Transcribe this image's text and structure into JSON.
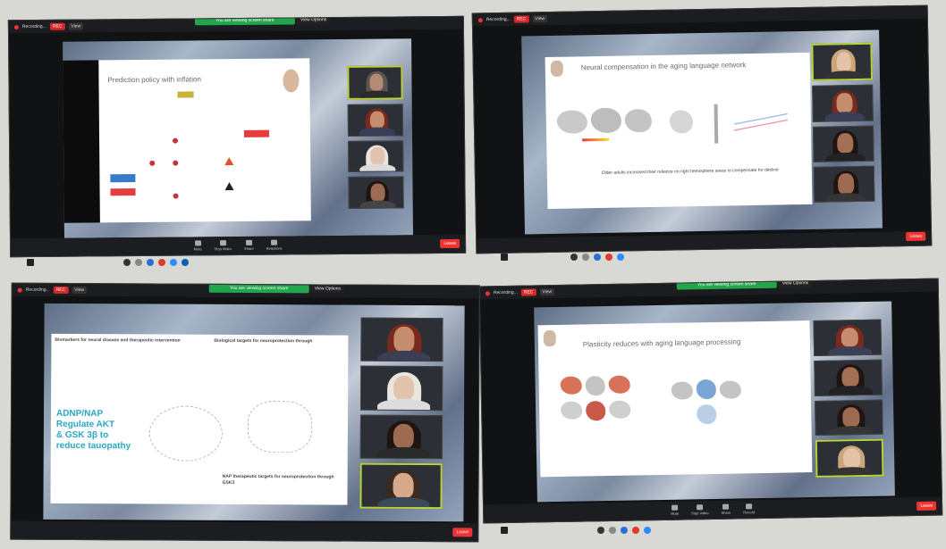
{
  "screens": [
    {
      "recording_label": "Recording...",
      "rec_badge": "REC",
      "view_label": "View",
      "share_banner": "You are viewing screen share",
      "stop_label": "View Options",
      "slide_title": "Prediction policy with inflation",
      "participants": [
        "",
        "",
        "",
        ""
      ]
    },
    {
      "recording_label": "Recording...",
      "rec_badge": "REC",
      "view_label": "View",
      "slide_title": "Neural compensation in the aging language network",
      "slide_caption": "Older adults increased their reliance on right hemisphere areas to compensate for decline",
      "participants": [
        "",
        "",
        "",
        ""
      ]
    },
    {
      "recording_label": "Recording...",
      "rec_badge": "REC",
      "view_label": "View",
      "share_banner": "You are viewing screen share",
      "stop_label": "View Options",
      "slide_heading_left": "Biomarkers for neural disease and therapeutic intervention",
      "slide_heading_right": "Biological targets for neuroprotection through",
      "slide_big_text": [
        "ADNP/NAP",
        "Regulate AKT",
        "& GSK 3β to",
        "reduce tauopathy"
      ],
      "slide_footer_text": "NAP therapeutic targets for neuroprotection through GSK3",
      "participants": [
        "",
        "",
        "",
        ""
      ]
    },
    {
      "recording_label": "Recording...",
      "rec_badge": "REC",
      "view_label": "View",
      "share_banner": "You are viewing screen share",
      "stop_label": "View Options",
      "slide_title": "Plasticity reduces with aging language processing",
      "participants": [
        "",
        "",
        "",
        ""
      ]
    }
  ],
  "toolbar": {
    "unmute": "Mute",
    "video": "Stop Video",
    "share": "Share",
    "record": "Record",
    "reactions": "Reactions",
    "leave": "Leave"
  },
  "colors": {
    "zoom_green": "#23a54b",
    "rec_red": "#d62828",
    "active_tile": "#b8d23c",
    "slide_teal": "#2aa8c6"
  },
  "icons": [
    "zoom-icon",
    "mic-icon",
    "camera-icon",
    "share-icon",
    "record-icon",
    "windows-start-icon",
    "browser-icon",
    "chrome-icon",
    "edge-icon"
  ]
}
